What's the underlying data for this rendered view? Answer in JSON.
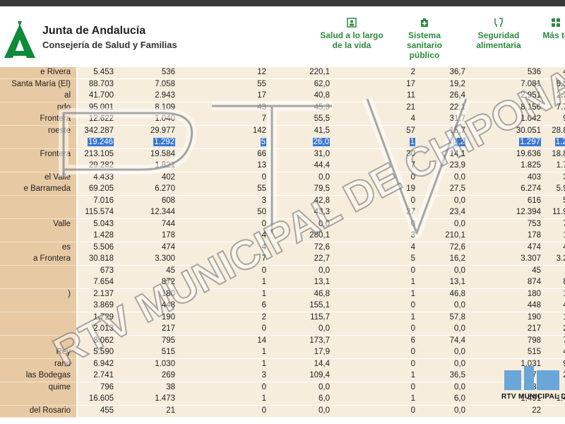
{
  "header": {
    "org_title": "Junta de Andalucía",
    "org_subtitle": "Consejería de Salud y Familias",
    "categories": [
      {
        "icon": "person-icon",
        "lines": [
          "Salud a lo largo",
          "de la vida"
        ]
      },
      {
        "icon": "hospital-icon",
        "lines": [
          "Sistema",
          "sanitario",
          "público"
        ]
      },
      {
        "icon": "food-safety-icon",
        "lines": [
          "Seguridad",
          "alimentaria"
        ]
      },
      {
        "icon": "grid-icon",
        "lines": [
          "Más te"
        ]
      }
    ]
  },
  "table": {
    "rows": [
      {
        "name": "e Rivera",
        "c": [
          "5.453",
          "536",
          "12",
          "220,1",
          "2",
          "36,7",
          "536",
          "48"
        ]
      },
      {
        "name": "Santa María (El)",
        "c": [
          "88.703",
          "7.058",
          "55",
          "62,0",
          "17",
          "19,2",
          "7.081",
          "6.59"
        ]
      },
      {
        "name": "al",
        "c": [
          "41.700",
          "2.943",
          "17",
          "40,8",
          "11",
          "26,4",
          "2.951",
          "2.77"
        ]
      },
      {
        "name": "ndo",
        "c": [
          "95.001",
          "8.109",
          "43",
          "45,3",
          "21",
          "22,1",
          "8.156",
          "7.70"
        ]
      },
      {
        "name": "Frontera",
        "c": [
          "12.622",
          "1.040",
          "7",
          "55,5",
          "4",
          "31,7",
          "1.042",
          "95"
        ]
      },
      {
        "name": "roeste",
        "c": [
          "342.287",
          "29.977",
          "142",
          "41,5",
          "57",
          "16,7",
          "30.051",
          "28.80"
        ]
      },
      {
        "name": "",
        "c": [
          "19.246",
          "1.292",
          "5",
          "26,0",
          "1",
          "5,2",
          "1.297",
          "1.22"
        ],
        "selected": true
      },
      {
        "name": "Frontera",
        "c": [
          "213.105",
          "19.584",
          "66",
          "31,0",
          "30",
          "14,1",
          "19.636",
          "18.89"
        ]
      },
      {
        "name": "",
        "c": [
          "29.282",
          "1.821",
          "13",
          "44,4",
          "7",
          "23,9",
          "1.825",
          "1.71"
        ]
      },
      {
        "name": "el Valle",
        "c": [
          "4.433",
          "402",
          "0",
          "0,0",
          "0",
          "0,0",
          "403",
          "39"
        ]
      },
      {
        "name": "e Barrameda",
        "c": [
          "69.205",
          "6.270",
          "55",
          "79,5",
          "19",
          "27,5",
          "6.274",
          "5.98"
        ]
      },
      {
        "name": "",
        "c": [
          "7.016",
          "608",
          "3",
          "42,8",
          "0",
          "0,0",
          "616",
          "59"
        ]
      },
      {
        "name": "",
        "c": [
          "115.574",
          "12.344",
          "50",
          "43,3",
          "27",
          "23,4",
          "12.394",
          "11.91"
        ]
      },
      {
        "name": "Valle",
        "c": [
          "5.043",
          "744",
          "0",
          "0,0",
          "0",
          "0,0",
          "753",
          "72"
        ]
      },
      {
        "name": "",
        "c": [
          "1.428",
          "178",
          "4",
          "280,1",
          "3",
          "210,1",
          "178",
          "16"
        ]
      },
      {
        "name": "es",
        "c": [
          "5.506",
          "474",
          "4",
          "72,6",
          "4",
          "72,6",
          "474",
          "44"
        ]
      },
      {
        "name": "a Frontera",
        "c": [
          "30.818",
          "3.300",
          "7",
          "22,7",
          "5",
          "16,2",
          "3.307",
          "3.21"
        ]
      },
      {
        "name": "",
        "c": [
          "673",
          "45",
          "0",
          "0,0",
          "0",
          "0,0",
          "45",
          "4"
        ]
      },
      {
        "name": "",
        "c": [
          "7.654",
          "872",
          "1",
          "13,1",
          "1",
          "13,1",
          "874",
          "84"
        ]
      },
      {
        "name": ")",
        "c": [
          "2.137",
          "180",
          "1",
          "46,8",
          "1",
          "46,8",
          "180",
          "16"
        ]
      },
      {
        "name": "",
        "c": [
          "3.869",
          "448",
          "6",
          "155,1",
          "0",
          "0,0",
          "448",
          "42"
        ]
      },
      {
        "name": "",
        "c": [
          "1.729",
          "190",
          "2",
          "115,7",
          "1",
          "57,8",
          "190",
          "17"
        ]
      },
      {
        "name": "",
        "c": [
          "2.013",
          "217",
          "0",
          "0,0",
          "0",
          "0,0",
          "217",
          "21"
        ]
      },
      {
        "name": "",
        "c": [
          "8.062",
          "795",
          "14",
          "173,7",
          "6",
          "74,4",
          "798",
          "76"
        ]
      },
      {
        "name": "Rey",
        "c": [
          "5.590",
          "515",
          "1",
          "17,9",
          "0",
          "0,0",
          "515",
          "49"
        ]
      },
      {
        "name": "rano",
        "c": [
          "6.942",
          "1.030",
          "1",
          "14,4",
          "0",
          "0,0",
          "1.031",
          "98"
        ]
      },
      {
        "name": "las Bodegas",
        "c": [
          "2.741",
          "269",
          "3",
          "109,4",
          "1",
          "36,5",
          "270",
          "25"
        ]
      },
      {
        "name": "quime",
        "c": [
          "796",
          "38",
          "0",
          "0,0",
          "0",
          "0,0",
          "38",
          "3"
        ]
      },
      {
        "name": "",
        "c": [
          "16.605",
          "1.473",
          "1",
          "6,0",
          "1",
          "6,0",
          "1.491",
          "1.44"
        ]
      },
      {
        "name": "del Rosario",
        "c": [
          "455",
          "21",
          "0",
          "0,0",
          "0",
          "0,0",
          "22",
          "2"
        ]
      }
    ]
  },
  "watermark": {
    "main_text": "RTV MUNICIPAL DE CHIPONA",
    "corner_text": "RTV MUNICIPAL DE CHI"
  },
  "colors": {
    "brand_green": "#0e8a3a",
    "category_green": "#2e8a3e",
    "name_cell": "#e7c9a3",
    "data_cell": "#f6eddd",
    "selection": "#3a78d4"
  }
}
